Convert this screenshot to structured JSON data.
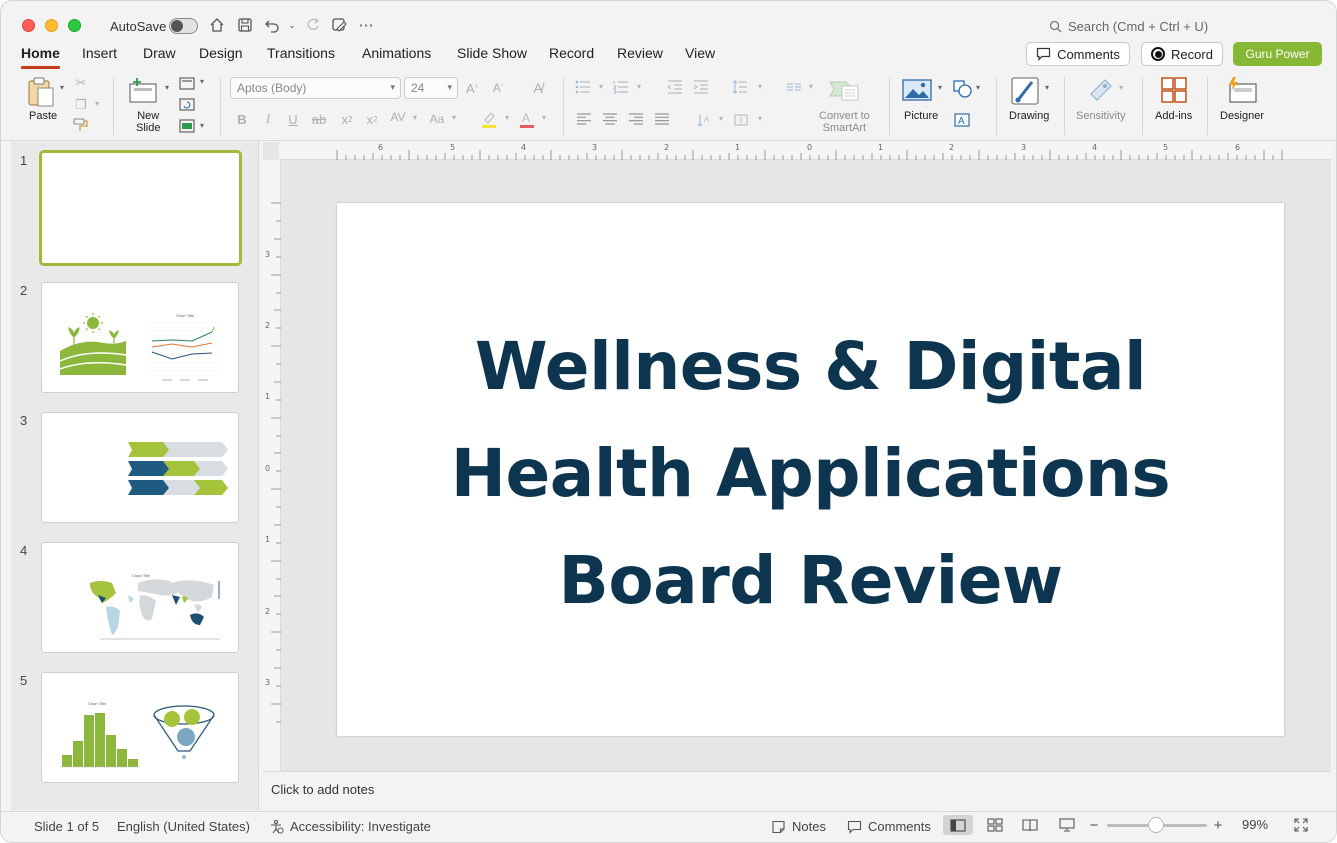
{
  "titlebar": {
    "autosave_label": "AutoSave",
    "search_placeholder": "Search (Cmd + Ctrl + U)"
  },
  "tabs": [
    "Home",
    "Insert",
    "Draw",
    "Design",
    "Transitions",
    "Animations",
    "Slide Show",
    "Record",
    "Review",
    "View"
  ],
  "actions": {
    "comments": "Comments",
    "record": "Record",
    "guru": "Guru Power"
  },
  "ribbon": {
    "paste": "Paste",
    "new_slide": "New\nSlide",
    "font_name": "Aptos (Body)",
    "font_size": "24",
    "convert_smartart": "Convert to\nSmartArt",
    "picture": "Picture",
    "drawing": "Drawing",
    "sensitivity": "Sensitivity",
    "addins": "Add-ins",
    "designer": "Designer"
  },
  "slides": [
    {
      "number": "1"
    },
    {
      "number": "2"
    },
    {
      "number": "3"
    },
    {
      "number": "4"
    },
    {
      "number": "5"
    }
  ],
  "thumbnail_text": {
    "chart_title": "Chart Title"
  },
  "slide": {
    "title_line1": "Wellness & Digital",
    "title_line2": "Health Applications",
    "title_line3": "Board Review"
  },
  "notes_placeholder": "Click to add notes",
  "ruler_top_numbers": [
    "6",
    "5",
    "4",
    "3",
    "2",
    "1",
    "0",
    "1",
    "2",
    "3",
    "4",
    "5",
    "6"
  ],
  "ruler_left_numbers": [
    "3",
    "2",
    "1",
    "0",
    "1",
    "2",
    "3"
  ],
  "status": {
    "slide_info": "Slide 1 of 5",
    "language": "English (United States)",
    "accessibility": "Accessibility: Investigate",
    "notes": "Notes",
    "comments": "Comments",
    "zoom": "99%"
  },
  "colors": {
    "title_text": "#0e3550",
    "accent_green": "#86b735",
    "accent_navy": "#1e5a7e",
    "active_tab_underline": "#c43e1c"
  }
}
